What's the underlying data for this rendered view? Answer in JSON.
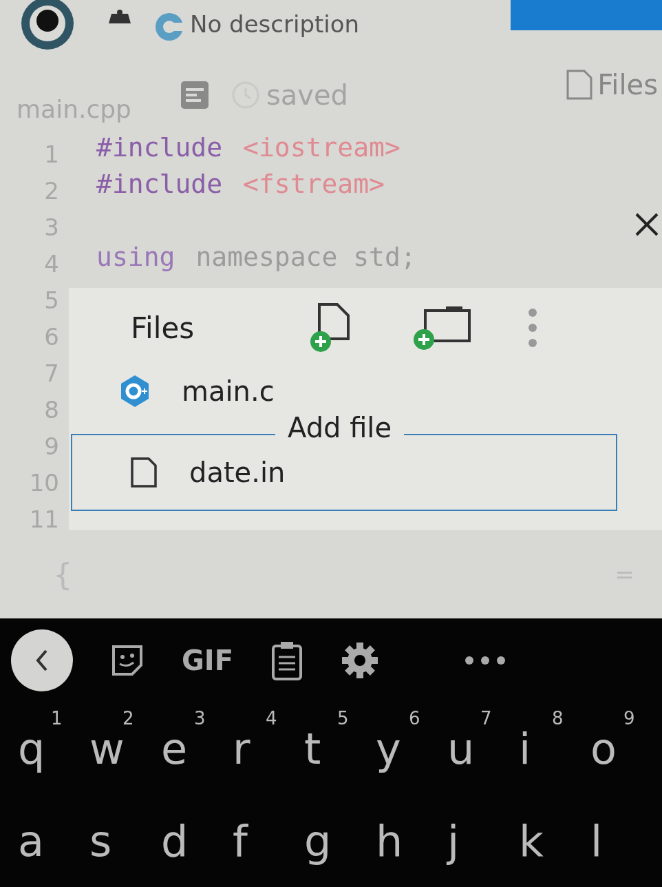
{
  "header": {
    "description": "No description"
  },
  "editor_bar": {
    "filename": "main.cpp",
    "save_status": "saved",
    "files_label": "Files"
  },
  "editor": {
    "line_numbers": [
      "1",
      "2",
      "3",
      "4",
      "5",
      "6",
      "7",
      "8",
      "9",
      "10",
      "11"
    ],
    "lines": [
      {
        "kind": "code",
        "tokens": [
          {
            "kind": "directive",
            "text": "#include"
          },
          {
            "kind": "string",
            "text": "<iostream>"
          }
        ]
      },
      {
        "kind": "code",
        "tokens": [
          {
            "kind": "directive",
            "text": "#include"
          },
          {
            "kind": "string",
            "text": "<fstream>"
          }
        ]
      },
      {
        "kind": "blank"
      },
      {
        "kind": "code",
        "tokens": [
          {
            "kind": "keyword",
            "text": "using"
          },
          {
            "kind": "plain",
            "text": "namespace std;"
          }
        ]
      }
    ],
    "trailing_line": "{",
    "trailing_mark": "="
  },
  "files_dialog": {
    "title": "Files",
    "files": [
      {
        "name": "main.c",
        "kind": "cpp"
      }
    ],
    "new_file_field": {
      "label": "Add file",
      "value": "date.in"
    }
  },
  "keyboard": {
    "toolbar": [
      {
        "kind": "back"
      },
      {
        "kind": "sticker"
      },
      {
        "kind": "gif",
        "text": "GIF"
      },
      {
        "kind": "clipboard"
      },
      {
        "kind": "settings"
      },
      {
        "kind": "more"
      }
    ],
    "rows": [
      [
        {
          "key": "q",
          "hint": "1"
        },
        {
          "key": "w",
          "hint": "2"
        },
        {
          "key": "e",
          "hint": "3"
        },
        {
          "key": "r",
          "hint": "4"
        },
        {
          "key": "t",
          "hint": "5"
        },
        {
          "key": "y",
          "hint": "6"
        },
        {
          "key": "u",
          "hint": "7"
        },
        {
          "key": "i",
          "hint": "8"
        },
        {
          "key": "o",
          "hint": "9"
        }
      ],
      [
        {
          "key": "a"
        },
        {
          "key": "s"
        },
        {
          "key": "d"
        },
        {
          "key": "f"
        },
        {
          "key": "g"
        },
        {
          "key": "h"
        },
        {
          "key": "j"
        },
        {
          "key": "k"
        },
        {
          "key": "l"
        }
      ]
    ]
  }
}
